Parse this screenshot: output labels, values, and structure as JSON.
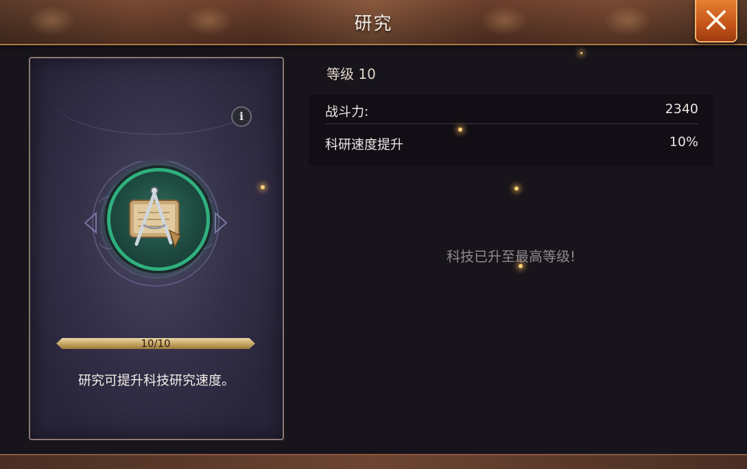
{
  "header": {
    "title": "研究"
  },
  "card": {
    "progress": {
      "label": "10/10",
      "fraction": 1.0
    },
    "description": "研究可提升科技研究速度。",
    "icon": "compass-parchment-icon"
  },
  "details": {
    "level_label": "等级 10",
    "stats": [
      {
        "label": "战斗力:",
        "value": "2340"
      },
      {
        "label": "科研速度提升",
        "value": "10%"
      }
    ],
    "max_message": "科技已升至最高等级!"
  },
  "colors": {
    "accent_orange": "#d8672a",
    "medal_ring": "#2fb07e",
    "progress_gold": "#c9a867"
  }
}
